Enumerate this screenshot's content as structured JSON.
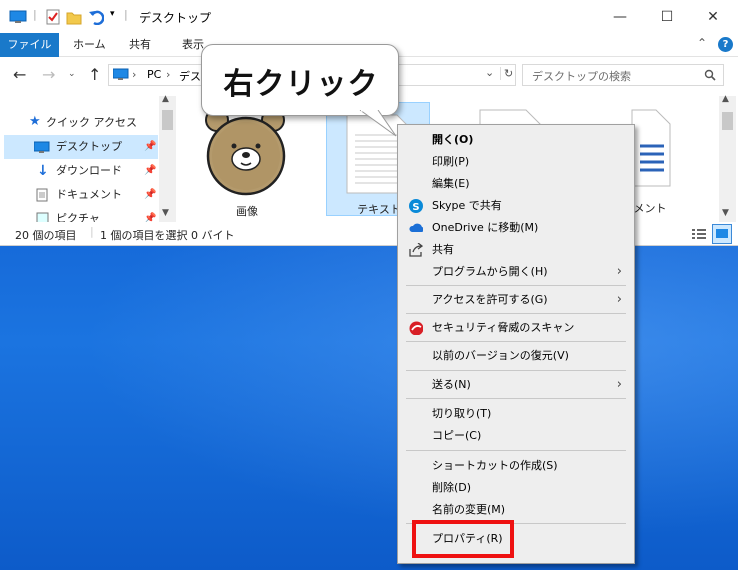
{
  "window": {
    "title": "デスクトップ",
    "controls": {
      "minimize": "—",
      "maximize": "☐",
      "close": "✕"
    },
    "help": "?",
    "collapse": "⌃"
  },
  "ribbon": {
    "tabs": [
      "ファイル",
      "ホーム",
      "共有",
      "表示"
    ]
  },
  "address": {
    "crumbs": [
      "PC",
      "デス"
    ],
    "separator": "›",
    "dropdown": "⌄",
    "refresh": "↻",
    "search_placeholder": "デスクトップの検索"
  },
  "nav": {
    "items": [
      {
        "label": "クイック アクセス",
        "icon": "star-icon"
      },
      {
        "label": "デスクトップ",
        "icon": "desktop-icon",
        "selected": true
      },
      {
        "label": "ダウンロード",
        "icon": "download-icon"
      },
      {
        "label": "ドキュメント",
        "icon": "document-icon"
      },
      {
        "label": "ピクチャ",
        "icon": "picture-icon"
      }
    ]
  },
  "files": [
    {
      "label": "画像",
      "type": "image"
    },
    {
      "label": "テキスト",
      "type": "text",
      "selected": true
    },
    {
      "label": "メント",
      "type": "document"
    }
  ],
  "status": {
    "count": "20 個の項目",
    "selection": "1 個の項目を選択  0 バイト"
  },
  "callout": {
    "text": "右クリック"
  },
  "context_menu": {
    "items": [
      {
        "label": "開く(O)",
        "bold": true
      },
      {
        "label": "印刷(P)"
      },
      {
        "label": "編集(E)"
      },
      {
        "label": "Skype で共有",
        "icon": "skype-icon"
      },
      {
        "label": "OneDrive に移動(M)",
        "icon": "onedrive-icon"
      },
      {
        "label": "共有",
        "icon": "share-icon"
      },
      {
        "label": "プログラムから開く(H)",
        "submenu": true
      },
      {
        "label": "アクセスを許可する(G)",
        "submenu": true
      },
      {
        "label": "セキュリティ脅威のスキャン",
        "icon": "trendmicro-icon"
      },
      {
        "label": "以前のバージョンの復元(V)"
      },
      {
        "label": "送る(N)",
        "submenu": true
      },
      {
        "label": "切り取り(T)"
      },
      {
        "label": "コピー(C)"
      },
      {
        "label": "ショートカットの作成(S)"
      },
      {
        "label": "削除(D)"
      },
      {
        "label": "名前の変更(M)"
      },
      {
        "label": "プロパティ(R)",
        "highlighted": true
      }
    ],
    "submenu_arrow": "›"
  },
  "colors": {
    "accent": "#1979ca",
    "selection": "#cce8ff",
    "highlight_box": "#ee1111",
    "desktop": "#1466d6"
  }
}
